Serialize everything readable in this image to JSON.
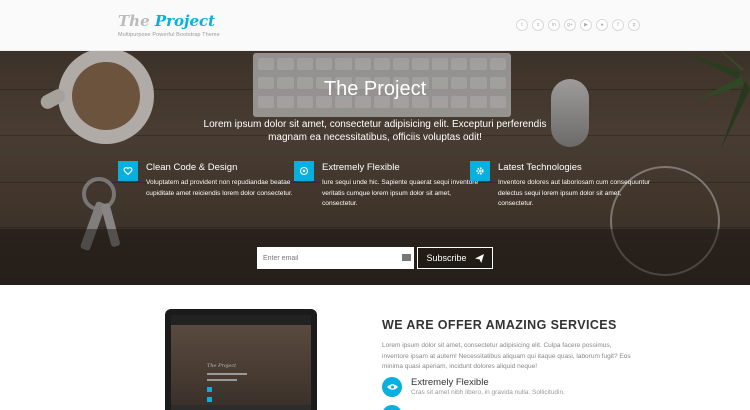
{
  "header": {
    "logo_word1": "The",
    "logo_word2": "Project",
    "tagline": "Multipurpose Powerful Bootstrap Theme",
    "social_icons": [
      "twitter-icon",
      "skype-icon",
      "linkedin-icon",
      "googleplus-icon",
      "youtube-icon",
      "flickr-icon",
      "facebook-icon",
      "pinterest-icon"
    ]
  },
  "hero": {
    "title": "The Project",
    "subtitle": "Lorem ipsum dolor sit amet, consectetur adipisicing elit. Excepturi perferendis magnam ea necessitatibus, officiis voluptas odit!",
    "features": [
      {
        "icon": "heart-icon",
        "title": "Clean Code & Design",
        "text": "Voluptatem ad provident non repudiandae beatae cupiditate amet reiciendis lorem dolor consectetur."
      },
      {
        "icon": "flexible-icon",
        "title": "Extremely Flexible",
        "text": "Iure sequi unde hic. Sapiente quaerat sequi inventore veritatis cumque lorem ipsum dolor sit amet, consectetur."
      },
      {
        "icon": "gear-icon",
        "title": "Latest Technologies",
        "text": "Inventore dolores aut laboriosam cum consequuntur delectus sequi lorem ipsum dolor sit amet, consectetur."
      }
    ],
    "email_placeholder": "Enter email",
    "subscribe_label": "Subscribe"
  },
  "services": {
    "title": "WE ARE OFFER AMAZING SERVICES",
    "text": "Lorem ipsum dolor sit amet, consectetur adipisicing elit. Culpa facere possimus, inventore ipsam at autem! Necessitatibus aliquam qui itaque quasi, laborum fugit? Eos minima quasi aperiam, incidunt dolores aliquid neque!",
    "items": [
      {
        "icon": "eye-icon",
        "title": "Extremely Flexible",
        "text": "Cras sit amet nibh libero, in gravida nulla. Sollicitudin."
      }
    ],
    "laptop_logo": "The Project"
  },
  "colors": {
    "accent": "#09afdf",
    "header_bg": "#fafafa"
  }
}
